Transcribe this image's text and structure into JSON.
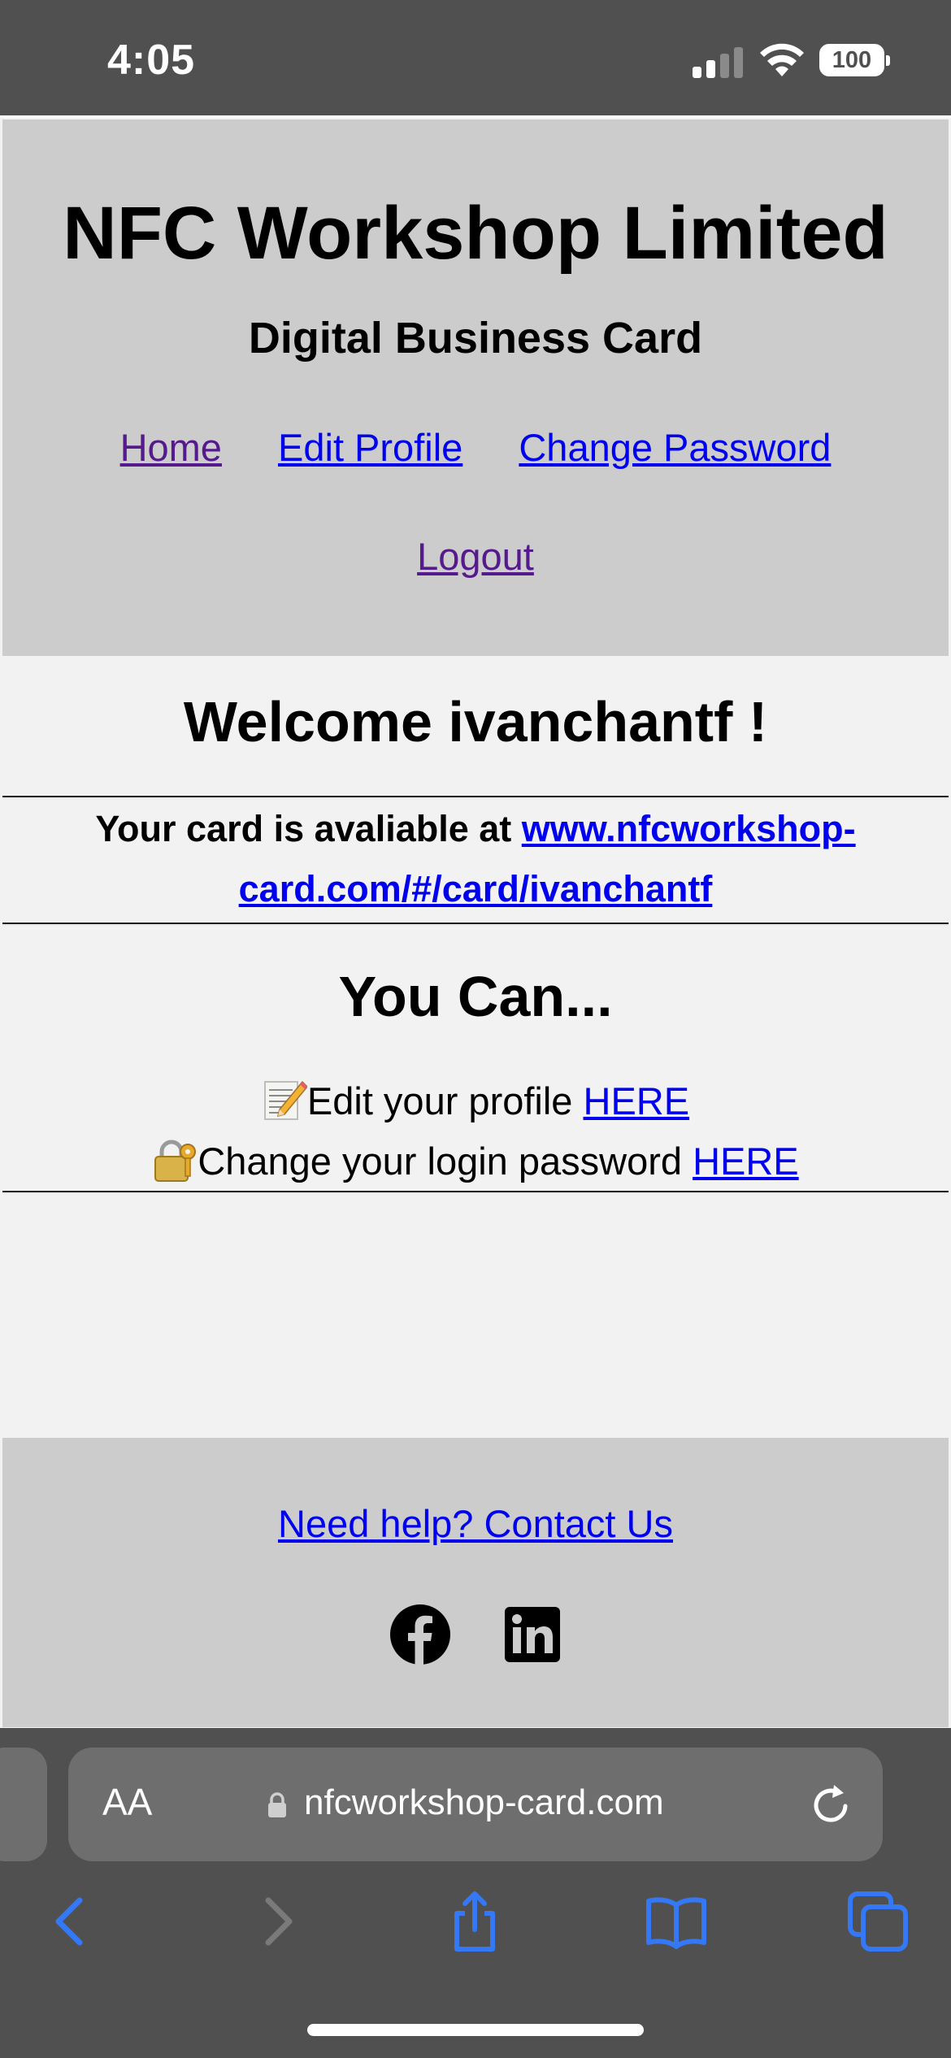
{
  "status_bar": {
    "time": "4:05",
    "battery": "100"
  },
  "header": {
    "title": "NFC Workshop Limited",
    "subtitle": "Digital Business Card",
    "nav": {
      "home": "Home",
      "edit_profile": "Edit Profile",
      "change_password": "Change Password",
      "logout": "Logout"
    }
  },
  "main": {
    "welcome": "Welcome ivanchantf !",
    "card_prefix": "Your card is avaliable at ",
    "card_link": "www.nfcworkshop-card.com/#/card/ivanchantf",
    "you_can_heading": "You Can...",
    "actions": [
      {
        "icon": "memo-pencil-icon",
        "text": "Edit your profile ",
        "link": "HERE"
      },
      {
        "icon": "lock-with-key-icon",
        "text": "Change your login password ",
        "link": "HERE"
      }
    ]
  },
  "footer": {
    "help_link": "Need help? Contact Us",
    "social": [
      "facebook-icon",
      "linkedin-icon"
    ]
  },
  "browser": {
    "text_size_button": "AA",
    "url": "nfcworkshop-card.com",
    "toolbar": [
      "back-icon",
      "forward-icon",
      "share-icon",
      "bookmarks-icon",
      "tabs-icon"
    ]
  },
  "colors": {
    "link": "#0000ee",
    "visited_link": "#551a8b",
    "header_bg": "#cccccc",
    "page_bg": "#f2f2f2",
    "chrome_bg": "#505050",
    "toolbar_accent": "#3478f6"
  }
}
